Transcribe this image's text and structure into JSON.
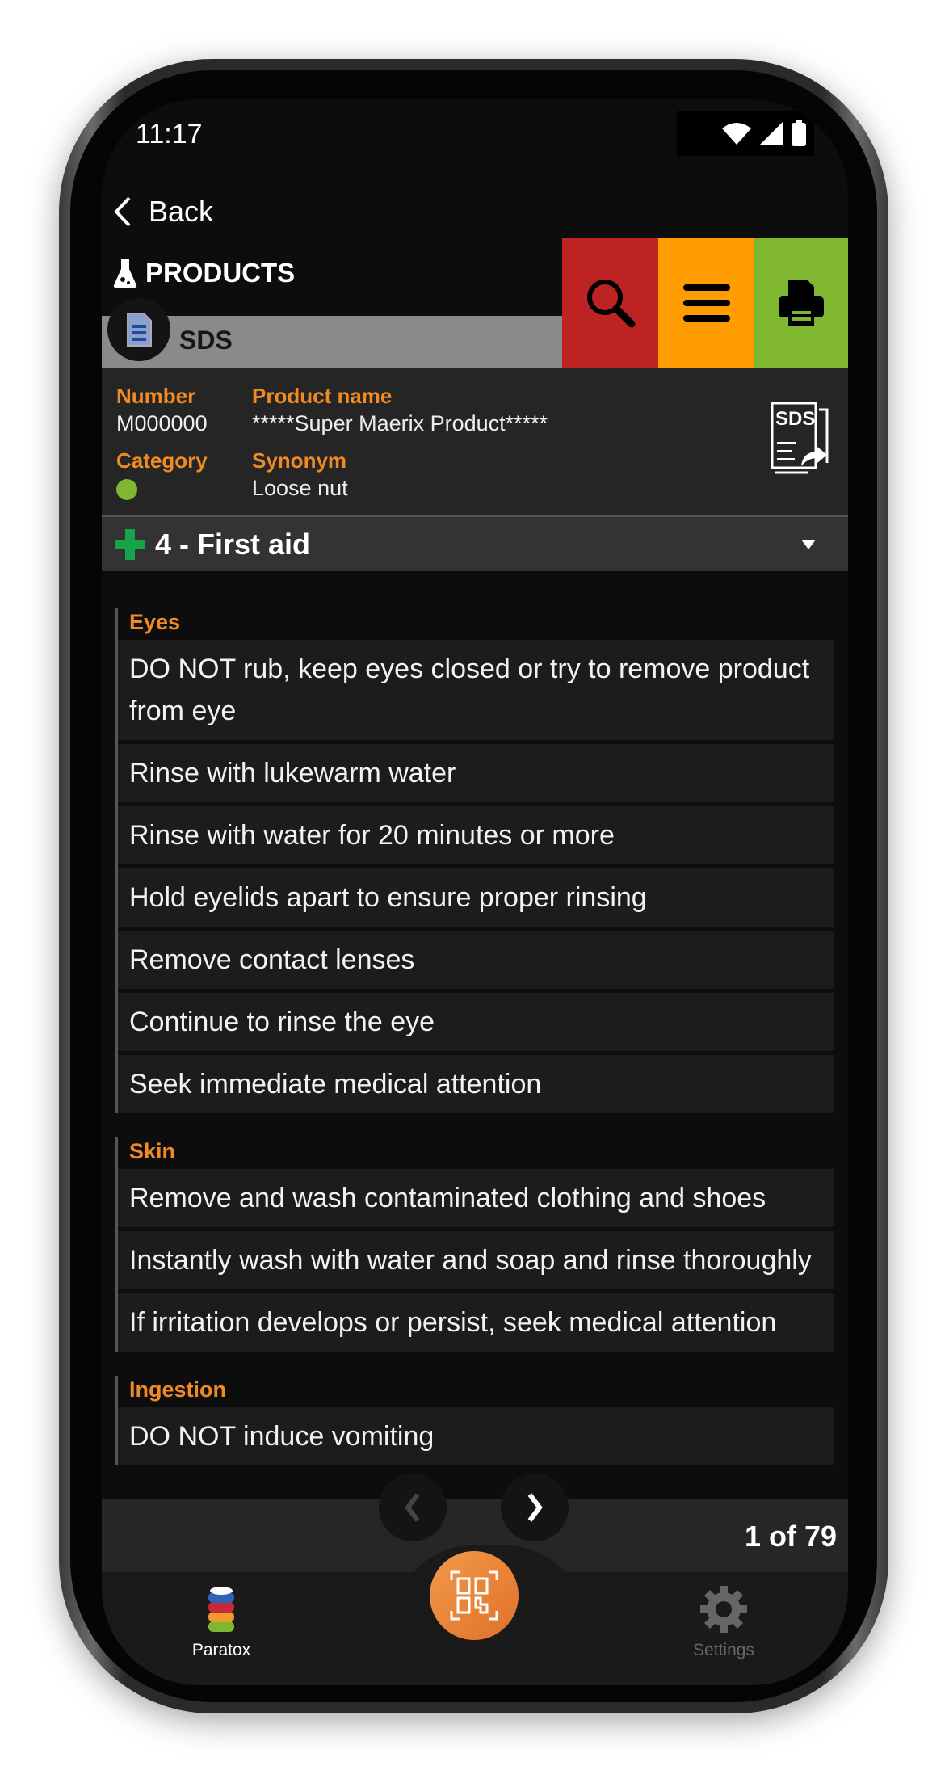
{
  "status": {
    "time": "11:17"
  },
  "nav": {
    "back_label": "Back",
    "title": "PRODUCTS",
    "subtitle": "SDS"
  },
  "colors": {
    "search": "#be2323",
    "menu": "#ff9c00",
    "print": "#7fb830",
    "accent": "#f08a24",
    "category_dot": "#7fb830",
    "qr": "#e8782c"
  },
  "product": {
    "number_label": "Number",
    "number": "M000000",
    "name_label": "Product name",
    "name": "*****Super Maerix Product*****",
    "category_label": "Category",
    "synonym_label": "Synonym",
    "synonym": "Loose nut",
    "sds_icon_text": "SDS"
  },
  "section": {
    "title": "4 - First aid"
  },
  "groups": [
    {
      "title": "Eyes",
      "items": [
        "DO NOT rub, keep eyes closed or try to remove product from eye",
        "Rinse with lukewarm water",
        "Rinse with water for 20 minutes or more",
        "Hold eyelids apart to ensure proper rinsing",
        "Remove contact lenses",
        "Continue to rinse the eye",
        "Seek immediate medical attention"
      ]
    },
    {
      "title": "Skin",
      "items": [
        "Remove and wash contaminated clothing and shoes",
        "Instantly wash with water and soap and rinse thoroughly",
        "If irritation develops or persist, seek medical attention"
      ]
    },
    {
      "title": "Ingestion",
      "items": [
        "DO NOT induce vomiting"
      ]
    }
  ],
  "pager": {
    "text": "1 of 79"
  },
  "tabs": {
    "paratox": "Paratox",
    "settings": "Settings"
  }
}
